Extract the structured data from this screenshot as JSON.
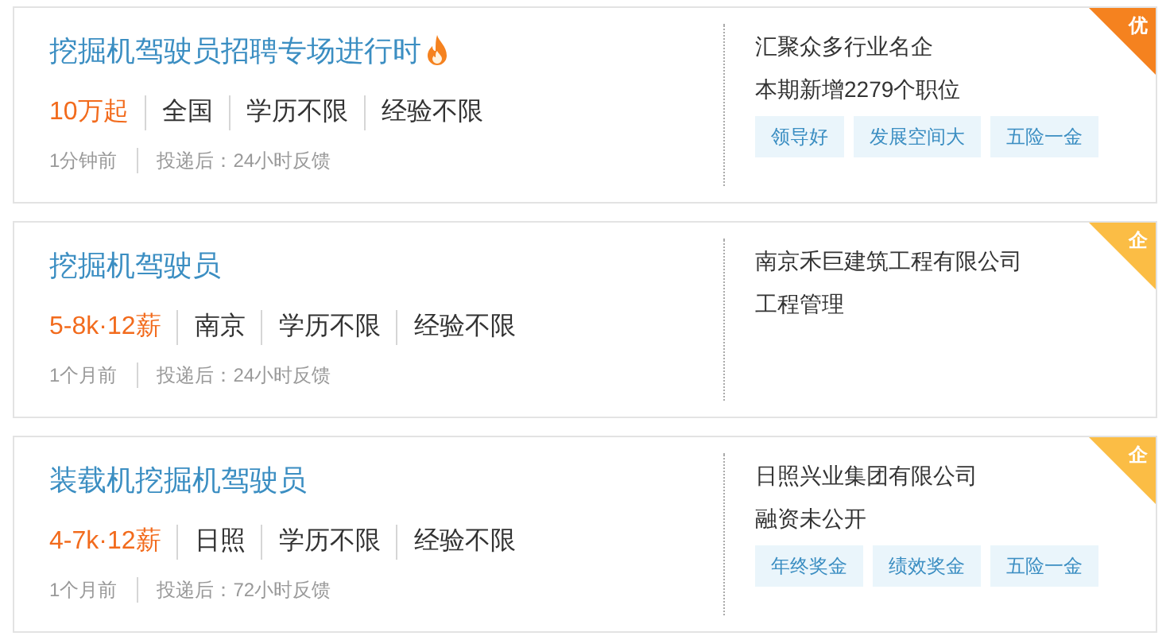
{
  "jobs": [
    {
      "title": "挖掘机驾驶员招聘专场进行时",
      "hot": true,
      "salary": "10万起",
      "details": [
        "全国",
        "学历不限",
        "经验不限"
      ],
      "posted": "1分钟前",
      "feedback": "投递后：24小时反馈",
      "company": "汇聚众多行业名企",
      "info": "本期新增2279个职位",
      "tags": [
        "领导好",
        "发展空间大",
        "五险一金"
      ],
      "badge": {
        "text": "优",
        "color": "#f5821f"
      }
    },
    {
      "title": "挖掘机驾驶员",
      "hot": false,
      "salary": "5-8k·12薪",
      "details": [
        "南京",
        "学历不限",
        "经验不限"
      ],
      "posted": "1个月前",
      "feedback": "投递后：24小时反馈",
      "company": "南京禾巨建筑工程有限公司",
      "info": "工程管理",
      "badge": {
        "text": "企",
        "color": "#fbbd45"
      }
    },
    {
      "title": "装载机挖掘机驾驶员",
      "hot": false,
      "salary": "4-7k·12薪",
      "details": [
        "日照",
        "学历不限",
        "经验不限"
      ],
      "posted": "1个月前",
      "feedback": "投递后：72小时反馈",
      "company": "日照兴业集团有限公司",
      "info": "融资未公开",
      "tags": [
        "年终奖金",
        "绩效奖金",
        "五险一金"
      ],
      "badge": {
        "text": "企",
        "color": "#fbbd45"
      }
    }
  ]
}
